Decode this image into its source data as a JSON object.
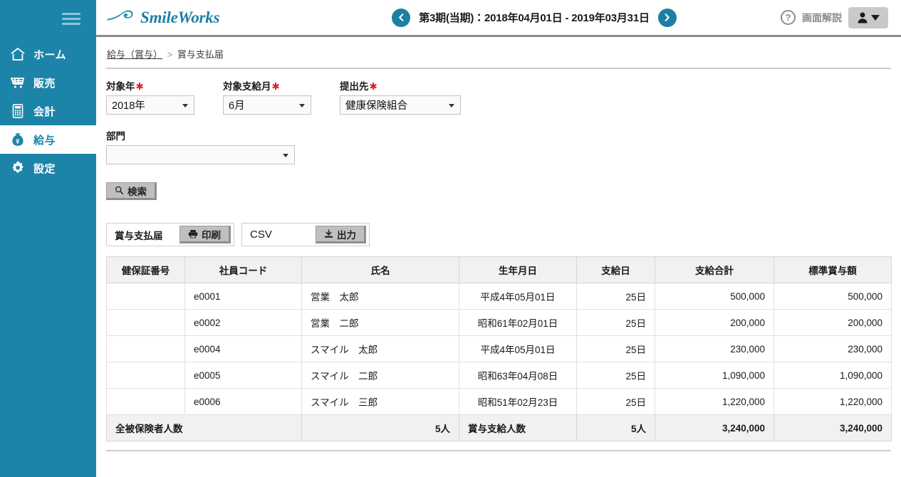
{
  "sidebar": {
    "menu_icon": "hamburger-icon",
    "items": [
      {
        "label": "ホーム",
        "icon": "home-icon",
        "active": false
      },
      {
        "label": "販売",
        "icon": "cart-icon",
        "active": false
      },
      {
        "label": "会計",
        "icon": "calculator-icon",
        "active": false
      },
      {
        "label": "給与",
        "icon": "money-bag-icon",
        "active": true
      },
      {
        "label": "設定",
        "icon": "gear-icon",
        "active": false
      }
    ]
  },
  "topbar": {
    "brand": "SmileWorks",
    "brand_icon": "smileworks-swoosh-logo",
    "prev_icon": "chevron-left-circle-icon",
    "next_icon": "chevron-right-circle-icon",
    "period_label": "第3期(当期)：2018年04月01日 - 2019年03月31日",
    "help_icon": "question-circle-icon",
    "help_label": "画面解説",
    "user_icon": "user-avatar-icon",
    "user_caret": "caret-down-icon",
    "accent_color": "#1e7fa5",
    "sidebar_color": "#1c84a8"
  },
  "breadcrumb": {
    "parent": "給与（賞与）",
    "separator": ">",
    "current": "賞与支払届"
  },
  "form": {
    "fields": [
      {
        "label": "対象年",
        "required": "✱",
        "value": "2018年"
      },
      {
        "label": "対象支給月",
        "required": "✱",
        "value": "6月"
      },
      {
        "label": "提出先",
        "required": "✱",
        "value": "健康保険組合"
      }
    ],
    "department": {
      "label": "部門",
      "value": "",
      "placeholder": ""
    },
    "search_button": {
      "label": "検索",
      "icon": "magnifier-icon"
    }
  },
  "export": {
    "print_group": {
      "label": "賞与支払届",
      "button_label": "印刷",
      "button_icon": "printer-icon"
    },
    "csv_group": {
      "label": "CSV",
      "button_label": "出力",
      "button_icon": "download-icon"
    }
  },
  "table": {
    "columns": [
      "健保証番号",
      "社員コード",
      "氏名",
      "生年月日",
      "支給日",
      "支給合計",
      "標準賞与額"
    ],
    "rows": [
      {
        "insurance_no": "",
        "employee_code": "e0001",
        "name": "営業　太郎",
        "birthdate": "平成4年05月01日",
        "pay_day": "25日",
        "pay_total": "500,000",
        "standard_bonus": "500,000"
      },
      {
        "insurance_no": "",
        "employee_code": "e0002",
        "name": "営業　二郎",
        "birthdate": "昭和61年02月01日",
        "pay_day": "25日",
        "pay_total": "200,000",
        "standard_bonus": "200,000"
      },
      {
        "insurance_no": "",
        "employee_code": "e0004",
        "name": "スマイル　太郎",
        "birthdate": "平成4年05月01日",
        "pay_day": "25日",
        "pay_total": "230,000",
        "standard_bonus": "230,000"
      },
      {
        "insurance_no": "",
        "employee_code": "e0005",
        "name": "スマイル　二郎",
        "birthdate": "昭和63年04月08日",
        "pay_day": "25日",
        "pay_total": "1,090,000",
        "standard_bonus": "1,090,000"
      },
      {
        "insurance_no": "",
        "employee_code": "e0006",
        "name": "スマイル　三郎",
        "birthdate": "昭和51年02月23日",
        "pay_day": "25日",
        "pay_total": "1,220,000",
        "standard_bonus": "1,220,000"
      }
    ],
    "footer": {
      "insured_label": "全被保険者人数",
      "insured_count": "5人",
      "paid_label": "賞与支給人数",
      "paid_count": "5人",
      "pay_total": "3,240,000",
      "standard_bonus_total": "3,240,000"
    }
  }
}
